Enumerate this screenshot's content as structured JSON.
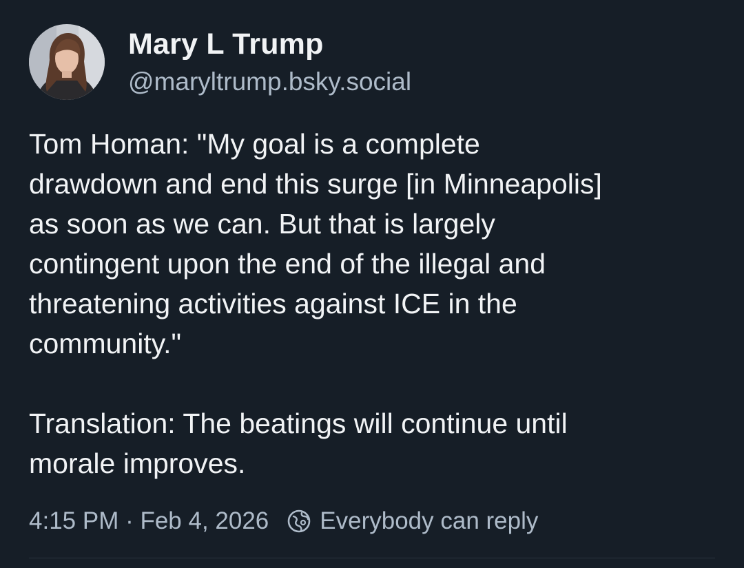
{
  "author": {
    "display_name": "Mary L Trump",
    "handle": "@maryltrump.bsky.social"
  },
  "post": {
    "paragraphs": [
      "Tom Homan: \"My goal is a complete\ndrawdown and end this surge [in Minneapolis]\nas soon as we can. But that is largely\ncontingent upon the end of the illegal and\nthreatening activities against ICE in the\ncommunity.\"",
      "Translation: The beatings will continue until\nmorale improves."
    ],
    "timestamp": "4:15 PM · Feb 4, 2026",
    "reply_setting": "Everybody can reply"
  },
  "icons": {
    "avatar": "avatar-photo",
    "reply_setting": "globe-icon"
  },
  "colors": {
    "background": "#161e27",
    "text": "#f1f3f5",
    "muted": "#aebbc9"
  }
}
